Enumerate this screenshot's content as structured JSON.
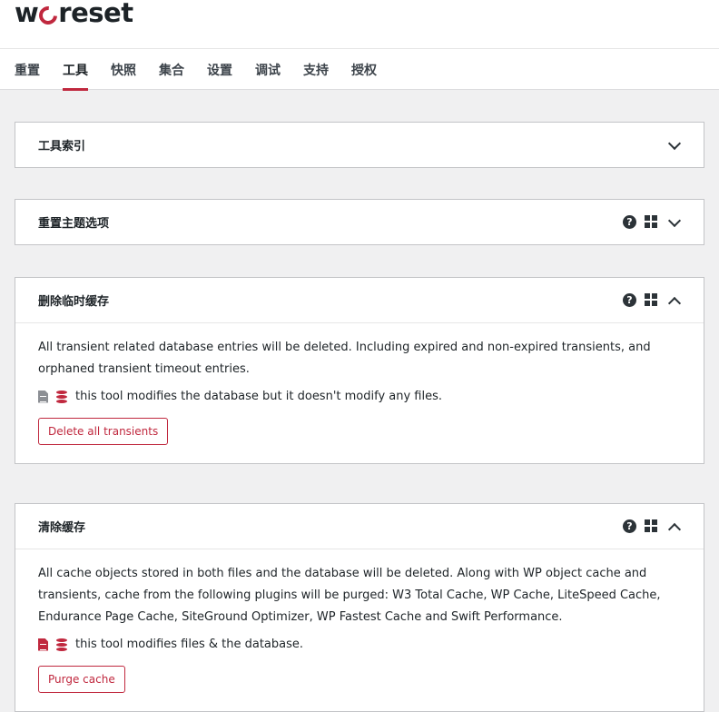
{
  "brand": {
    "logo_part1": "w",
    "logo_part2": "reset",
    "accent": "#c0283e"
  },
  "tabs": [
    {
      "label": "重置",
      "active": false
    },
    {
      "label": "工具",
      "active": true
    },
    {
      "label": "快照",
      "active": false
    },
    {
      "label": "集合",
      "active": false
    },
    {
      "label": "设置",
      "active": false
    },
    {
      "label": "调试",
      "active": false
    },
    {
      "label": "支持",
      "active": false
    },
    {
      "label": "授权",
      "active": false
    }
  ],
  "cards": [
    {
      "title": "工具索引",
      "expanded": false
    },
    {
      "title": "重置主题选项",
      "expanded": false
    },
    {
      "title": "删除临时缓存",
      "expanded": true,
      "description": "All transient related database entries will be deleted. Including expired and non-expired transients, and orphaned transient timeout entries.",
      "modifies_text": "this tool modifies the database but it doesn't modify any files.",
      "button_label": "Delete all transients"
    },
    {
      "title": "清除缓存",
      "expanded": true,
      "description": "All cache objects stored in both files and the database will be deleted. Along with WP object cache and transients, cache from the following plugins will be purged: W3 Total Cache, WP Cache, LiteSpeed Cache, Endurance Page Cache, SiteGround Optimizer, WP Fastest Cache and Swift Performance.",
      "modifies_text": "this tool modifies files & the database.",
      "button_label": "Purge cache"
    }
  ]
}
